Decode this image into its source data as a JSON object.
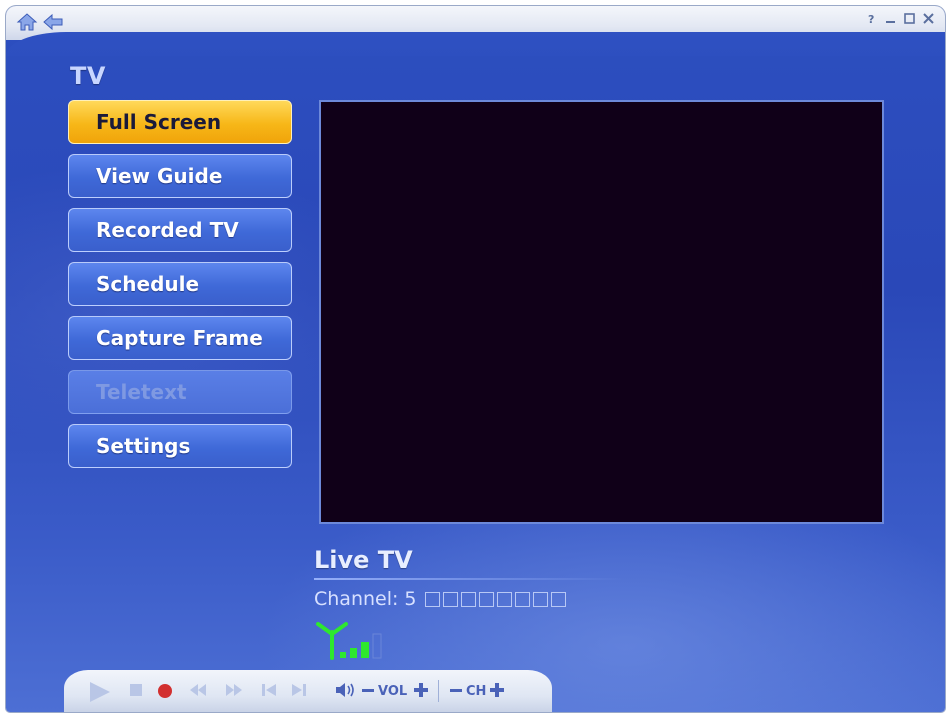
{
  "window": {
    "nav": [
      "home-icon",
      "back-icon"
    ],
    "controls": [
      "help-icon",
      "minimize-icon",
      "restore-icon",
      "close-icon"
    ]
  },
  "section": {
    "title": "TV"
  },
  "menu": {
    "items": [
      {
        "label": "Full Screen",
        "state": "active"
      },
      {
        "label": "View Guide",
        "state": "normal"
      },
      {
        "label": "Recorded TV",
        "state": "normal"
      },
      {
        "label": "Schedule",
        "state": "normal"
      },
      {
        "label": "Capture Frame",
        "state": "normal"
      },
      {
        "label": "Teletext",
        "state": "disabled"
      },
      {
        "label": "Settings",
        "state": "normal"
      }
    ]
  },
  "video": {
    "background": "#100018"
  },
  "status": {
    "title": "Live TV",
    "channel_label": "Channel:",
    "channel_number": "5",
    "signal_icon": "antenna-signal-icon"
  },
  "transport": {
    "buttons": [
      "play-icon",
      "stop-icon",
      "record-icon",
      "rewind-icon",
      "fast-forward-icon",
      "skip-back-icon",
      "skip-forward-icon"
    ],
    "mute_icon": "speaker-icon",
    "vol_label": "VOL",
    "ch_label": "CH"
  },
  "colors": {
    "accent_active": "#f7b718",
    "background": "#2d4fc0",
    "signal": "#2ee82e"
  }
}
